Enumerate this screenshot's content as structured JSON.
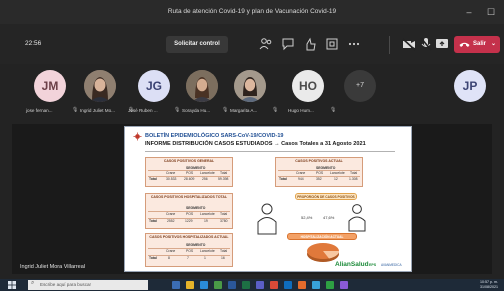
{
  "window": {
    "title": "Ruta de atención Covid-19 y plan de Vacunación Covid-19",
    "minimize": "–",
    "maximize": "☐"
  },
  "toolbar": {
    "clock": "22:56",
    "request_control": "Solicitar control",
    "leave_label": "Salir"
  },
  "participants": [
    {
      "initials": "JM",
      "name": "jose fernan..."
    },
    {
      "initials": "",
      "name": "Ingrid Juliet Mo..."
    },
    {
      "initials": "JG",
      "name": "José Ruben ..."
    },
    {
      "initials": "",
      "name": "Sorayda Hu..."
    },
    {
      "initials": "",
      "name": "Margarita A..."
    },
    {
      "initials": "HO",
      "name": "Hugo Hum..."
    },
    {
      "initials": "+7",
      "name": ""
    }
  ],
  "self_avatar": "JP",
  "presenter": "Ingrid Juliet Mora Villarreal",
  "slide": {
    "title": "BOLETÍN EPIDEMIOLÓGICO SARS-CoV-19/COVID-19",
    "subtitle": "INFORME DISTRIBUCIÓN CASOS ESTUDIADOS → Casos Totales a 31 Agosto 2021",
    "box1": {
      "header": "CASOS POSITIVOS GENERAL",
      "seg": "SEGMENTO",
      "cols": [
        "Crane",
        "POS",
        "Lancelote",
        "Total"
      ],
      "row_label": "Total",
      "values": [
        "30.533",
        "28.609",
        "256",
        "59.398"
      ]
    },
    "box2": {
      "header": "CASOS POSITIVOS ACTUAL",
      "seg": "SEGMENTO",
      "cols": [
        "Crane",
        "POS",
        "Lancelote",
        "Total"
      ],
      "row_label": "Total",
      "values": [
        "944",
        "352",
        "12",
        "1.308"
      ]
    },
    "box3": {
      "header": "CASOS POSITIVOS HOSPITALIZADOS TOTAL",
      "seg": "SEGMENTO",
      "cols": [
        "Crane",
        "POS",
        "Lancelote",
        "Total"
      ],
      "row_label": "Total",
      "values": [
        "2552",
        "1229",
        "19",
        "3780"
      ]
    },
    "box4": {
      "header": "CASOS POSITIVOS HOSPITALIZADOS ACTUAL",
      "seg": "SEGMENTO",
      "cols": [
        "Crane",
        "POS",
        "Lancelote",
        "Total"
      ],
      "row_label": "Total",
      "values": [
        "8",
        "7",
        "1",
        "16"
      ]
    },
    "pill_label": "PROPORCIÓN DE CASOS POSITIVOS",
    "pct_a": "52,4%",
    "pct_b": "47,6%",
    "hosp_header": "HOSPITALIZACIÓN ACTUAL",
    "logo_text": "AlianSalud",
    "logo_sub": "EPS",
    "partner": "AVANMEDICA"
  },
  "taskbar": {
    "search_placeholder": "Escribe aquí para buscar",
    "time": "10:57 p. m.",
    "date": "31/08/2021"
  },
  "colors": {
    "leave": "#c4314b",
    "slide_title": "#1f4e93",
    "table_fill": "#fbe9df",
    "pie": "#e0793b"
  }
}
